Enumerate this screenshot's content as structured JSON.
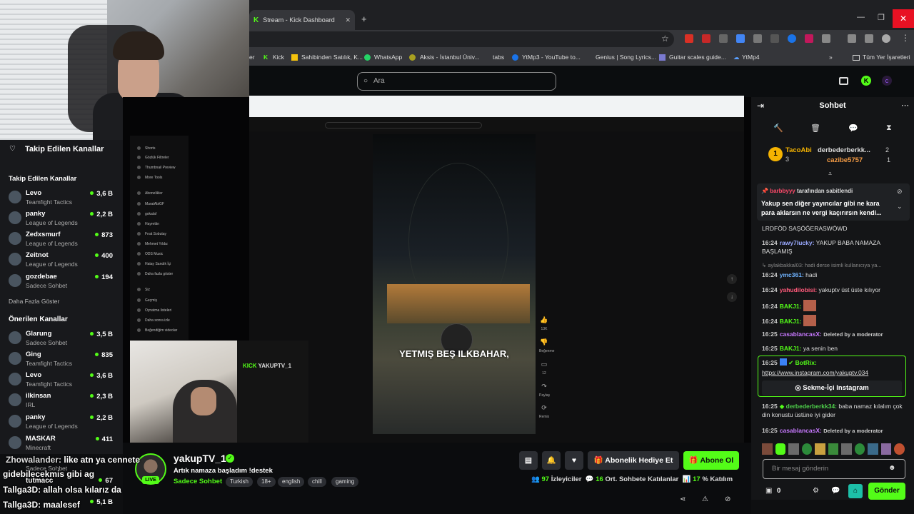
{
  "browser": {
    "tab_title": "Stream - Kick Dashboard",
    "bookmarks": [
      "er",
      "Kick",
      "Sahibinden Satılık, K...",
      "WhatsApp",
      "Aksis - İstanbul Üniv...",
      "tabs",
      "YtMp3 - YouTube to...",
      "Genius | Song Lyrics...",
      "Guitar scales guide...",
      "YtMp4",
      "Tüm Yer İşaretleri"
    ]
  },
  "search": {
    "placeholder": "Ara"
  },
  "sidebar": {
    "header": "Takip Edilen Kanallar",
    "followed_title": "Takip Edilen Kanallar",
    "followed": [
      {
        "name": "Levo",
        "game": "Teamfight Tactics",
        "viewers": "3,6 B"
      },
      {
        "name": "panky",
        "game": "League of Legends",
        "viewers": "2,2 B"
      },
      {
        "name": "Zedxsmurf",
        "game": "League of Legends",
        "viewers": "873"
      },
      {
        "name": "Zeitnot",
        "game": "League of Legends",
        "viewers": "400"
      },
      {
        "name": "gozdebae",
        "game": "Sadece Sohbet",
        "viewers": "194"
      }
    ],
    "show_more": "Daha Fazla Göster",
    "recommended_title": "Önerilen Kanallar",
    "recommended": [
      {
        "name": "Glarung",
        "game": "Sadece Sohbet",
        "viewers": "3,5 B"
      },
      {
        "name": "Ging",
        "game": "Teamfight Tactics",
        "viewers": "835"
      },
      {
        "name": "Levo",
        "game": "Teamfight Tactics",
        "viewers": "3,6 B"
      },
      {
        "name": "ilkinsan",
        "game": "IRL",
        "viewers": "2,3 B"
      },
      {
        "name": "panky",
        "game": "League of Legends",
        "viewers": "2,2 B"
      },
      {
        "name": "MASKAR",
        "game": "Minecraft",
        "viewers": "411"
      },
      {
        "name": "",
        "game": "Sadece Sohbet",
        "viewers": "67"
      },
      {
        "name": "",
        "game": "",
        "viewers": "5,1 B"
      }
    ]
  },
  "video": {
    "caption": "YETMIŞ BEŞ ILKBAHAR,",
    "cam_label_kick": "KICK",
    "cam_label_name": "YAKUPTV_1",
    "yt_menu": [
      "Shorts",
      "Gözlük Filtreler",
      "Thumbnail Preview",
      "More Tools",
      "Abonelikler",
      "MuratAbiGF",
      "gokalaf",
      "Hayrettin",
      "Fırat Sobutay",
      "Mehmet Yıldız",
      "ODS Music",
      "Hatay Sandık İçi",
      "Daha fazla göster",
      "Siz",
      "Geçmiş",
      "Oynatma listeleri",
      "Daha sonra izle",
      "Beğendiğim videolar"
    ],
    "short_actions": [
      "13K",
      "Beğenme",
      "12",
      "Paylaş",
      "Remix"
    ]
  },
  "stream": {
    "channel": "yakupTV_1",
    "live_badge": "LIVE",
    "title": "Artık namaza başladım !destek",
    "category": "Sadece Sohbet",
    "tags": [
      "Turkish",
      "18+",
      "english",
      "chill",
      "gaming"
    ],
    "gift_label": "Abonelik Hediye Et",
    "subscribe_label": "Abone Ol",
    "stats": {
      "viewers_value": "97",
      "viewers_label": "İzleyiciler",
      "chatters_value": "16",
      "chatters_label": "Ort. Sohbete Katılanlar",
      "percent_value": "17",
      "percent_label": "% Katılım"
    }
  },
  "overlay_chat": [
    {
      "user": "Zhowalander:",
      "text": "like atn ya cennete"
    },
    {
      "user": "",
      "text": "gidebilecekmis gibi ag"
    },
    {
      "user": "Tallga3D:",
      "text": "allah olsa kılarız da"
    },
    {
      "user": "Tallga3D:",
      "text": "maalesef"
    },
    {
      "user": "",
      "text": "tutmacc"
    }
  ],
  "chat": {
    "title": "Sohbet",
    "leaders": {
      "first_name": "TacoAbi",
      "first_count": "3",
      "second_name": "derbederberkk...",
      "second_count": "2",
      "third_name": "cazibe5757",
      "third_count": "1"
    },
    "pinned": {
      "by_user": "barbbyyy",
      "by_text": "tarafından sabitlendi",
      "message": "Yakup sen diğer yayıncılar gibi ne kara para aklarsın ne vergi kaçırırsın kendi..."
    },
    "messages": [
      {
        "time": "",
        "user": "",
        "text": "LRDFÖD SAŞÖĞERASWÖWD",
        "color": "#dddddd"
      },
      {
        "time": "16:24",
        "user": "rawy7lucky:",
        "text": "YAKUP BABA NAMAZA BAŞLAMIŞ",
        "color": "#9aa9ff"
      },
      {
        "time": "",
        "user": "",
        "text": "aylakbakkal03: hadi derse isimli kullanıcıya ya...",
        "color": "#888888"
      },
      {
        "time": "16:24",
        "user": "ymc361:",
        "text": "hadi",
        "color": "#6fb3ff"
      },
      {
        "time": "16:24",
        "user": "yahudilobisi:",
        "text": "yakuptv üst üste kılıyor",
        "color": "#ff5a7a"
      },
      {
        "time": "16:24",
        "user": "BAKJ1:",
        "text": "",
        "color": "#53fc18"
      },
      {
        "time": "16:24",
        "user": "BAKJ1:",
        "text": "",
        "color": "#53fc18"
      },
      {
        "time": "16:25",
        "user": "casablancasX:",
        "text": "Deleted by a moderator",
        "color": "#c779ff"
      },
      {
        "time": "16:25",
        "user": "BAKJ1:",
        "text": "ya senin ben",
        "color": "#53fc18"
      }
    ],
    "botrix": {
      "time": "16:25",
      "user": "BotRix:",
      "link": "https://www.instagram.com/yakuptv.034",
      "button": "Sekme-İçi Instagram"
    },
    "messages2": [
      {
        "time": "16:25",
        "user": "derbederberkk34:",
        "text": "baba namaz kılalım çok din konustu üstüne iyi gider",
        "color": "#4ed14a"
      },
      {
        "time": "16:25",
        "user": "casablancasX:",
        "text": "Deleted by a moderator",
        "color": "#c779ff"
      }
    ],
    "input_placeholder": "Bir mesaj gönderin",
    "points": "0",
    "send_label": "Gönder"
  },
  "colors": {
    "kick_green": "#53fc18",
    "bg": "#0e0f11",
    "panel": "#18191c"
  }
}
